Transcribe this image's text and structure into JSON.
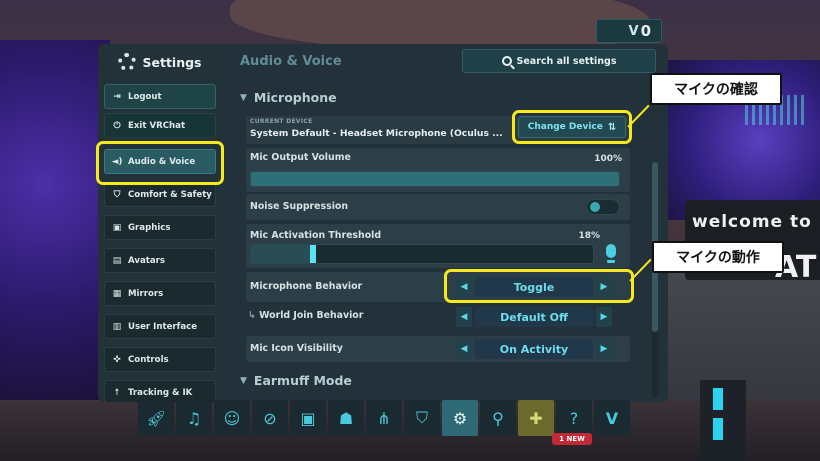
{
  "currency": {
    "amount": "0"
  },
  "sidebar": {
    "title": "Settings",
    "items": [
      {
        "label": "Logout",
        "icon": "logout-icon"
      },
      {
        "label": "Exit VRChat",
        "icon": "power-icon"
      },
      {
        "label": "Audio & Voice",
        "icon": "speaker-icon"
      },
      {
        "label": "Comfort & Safety",
        "icon": "shield-icon"
      },
      {
        "label": "Graphics",
        "icon": "image-icon"
      },
      {
        "label": "Avatars",
        "icon": "avatar-icon"
      },
      {
        "label": "Mirrors",
        "icon": "mirror-icon"
      },
      {
        "label": "User Interface",
        "icon": "ui-icon"
      },
      {
        "label": "Controls",
        "icon": "gamepad-icon"
      },
      {
        "label": "Tracking & IK",
        "icon": "figure-icon"
      }
    ]
  },
  "main": {
    "title": "Audio & Voice",
    "search_label": "Search all settings",
    "microphone_section": "Microphone",
    "current_device_caption": "CURRENT DEVICE",
    "current_device_name": "System Default - Headset Microphone (Oculus ...",
    "change_device_label": "Change Device",
    "mic_output_volume": {
      "label": "Mic Output Volume",
      "value_text": "100%",
      "level": 1.0
    },
    "noise_suppression": {
      "label": "Noise Suppression",
      "enabled": false
    },
    "mic_activation_threshold": {
      "label": "Mic Activation Threshold",
      "value_text": "18%",
      "level": 0.18
    },
    "microphone_behavior": {
      "label": "Microphone Behavior",
      "value": "Toggle"
    },
    "world_join_behavior": {
      "label": "World Join Behavior",
      "value": "Default Off"
    },
    "mic_icon_visibility": {
      "label": "Mic Icon Visibility",
      "value": "On Activity"
    },
    "earmuff_section": "Earmuff Mode"
  },
  "callouts": {
    "mic_check": "マイクの確認",
    "mic_behavior": "マイクの動作"
  },
  "scene": {
    "welcome_text": "welcome to",
    "welcome_partial": "AT"
  },
  "dock": {
    "new_badge": "1 NEW",
    "buttons": [
      "rocket-icon",
      "bell-icon",
      "social-icon",
      "planet-icon",
      "avatar-book-icon",
      "group-icon",
      "network-icon",
      "shield-icon",
      "settings-gear-icon",
      "search-icon",
      "chat-icon",
      "help-icon",
      "vrchat-logo-icon"
    ]
  },
  "colors": {
    "accent": "#5ae3f3",
    "highlight": "#f7ea1a",
    "panel": "#22313a",
    "new_badge": "#c02a38"
  }
}
